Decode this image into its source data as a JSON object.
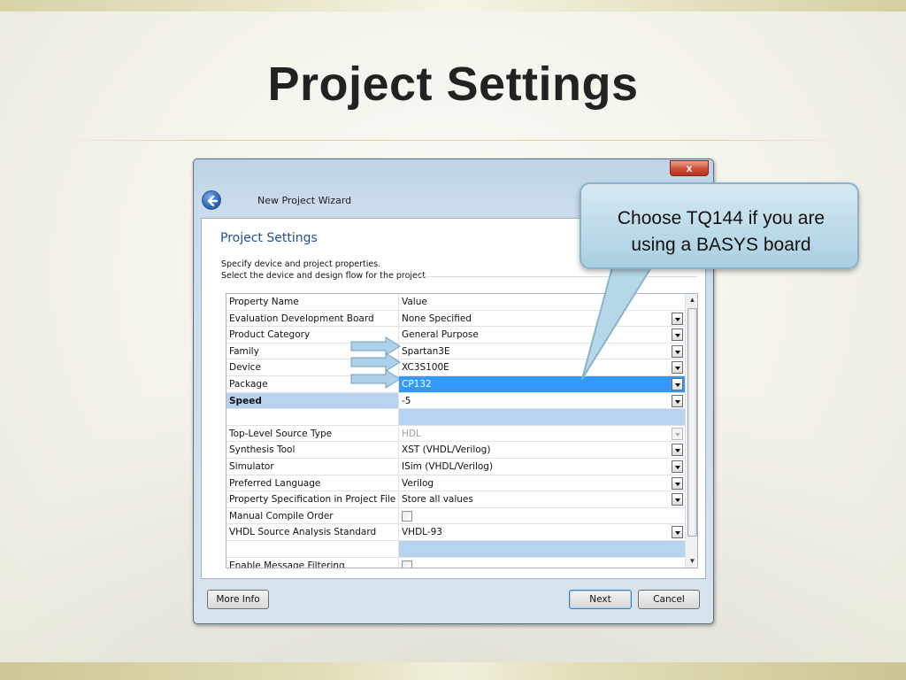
{
  "slide": {
    "title": "Project Settings"
  },
  "window": {
    "close_label": "x",
    "wizard_title": "New Project Wizard",
    "heading": "Project Settings",
    "desc_line1": "Specify device and project properties.",
    "desc_line2": "Select the device and design flow for the project"
  },
  "grid": {
    "header": {
      "name": "Property Name",
      "value": "Value"
    },
    "rows": [
      {
        "name": "Evaluation Development Board",
        "value": "None Specified"
      },
      {
        "name": "Product Category",
        "value": "General Purpose"
      },
      {
        "name": "Family",
        "value": "Spartan3E"
      },
      {
        "name": "Device",
        "value": "XC3S100E"
      },
      {
        "name": "Package",
        "value": "CP132"
      },
      {
        "name": "Speed",
        "value": "-5"
      },
      {
        "name": "",
        "value": ""
      },
      {
        "name": "Top-Level Source Type",
        "value": "HDL"
      },
      {
        "name": "Synthesis Tool",
        "value": "XST (VHDL/Verilog)"
      },
      {
        "name": "Simulator",
        "value": "ISim (VHDL/Verilog)"
      },
      {
        "name": "Preferred Language",
        "value": "Verilog"
      },
      {
        "name": "Property Specification in Project File",
        "value": "Store all values"
      },
      {
        "name": "Manual Compile Order",
        "value": ""
      },
      {
        "name": "VHDL Source Analysis Standard",
        "value": "VHDL-93"
      },
      {
        "name": "",
        "value": ""
      },
      {
        "name": "Enable Message Filtering",
        "value": ""
      }
    ]
  },
  "buttons": {
    "more_info": "More Info",
    "next": "Next",
    "cancel": "Cancel"
  },
  "callout": {
    "line1": "Choose  TQ144 if you are",
    "line2": "using a BASYS board"
  },
  "colors": {
    "selected": "#3399ff",
    "heading": "#1f4e96",
    "callout": "#a9cfe2"
  }
}
